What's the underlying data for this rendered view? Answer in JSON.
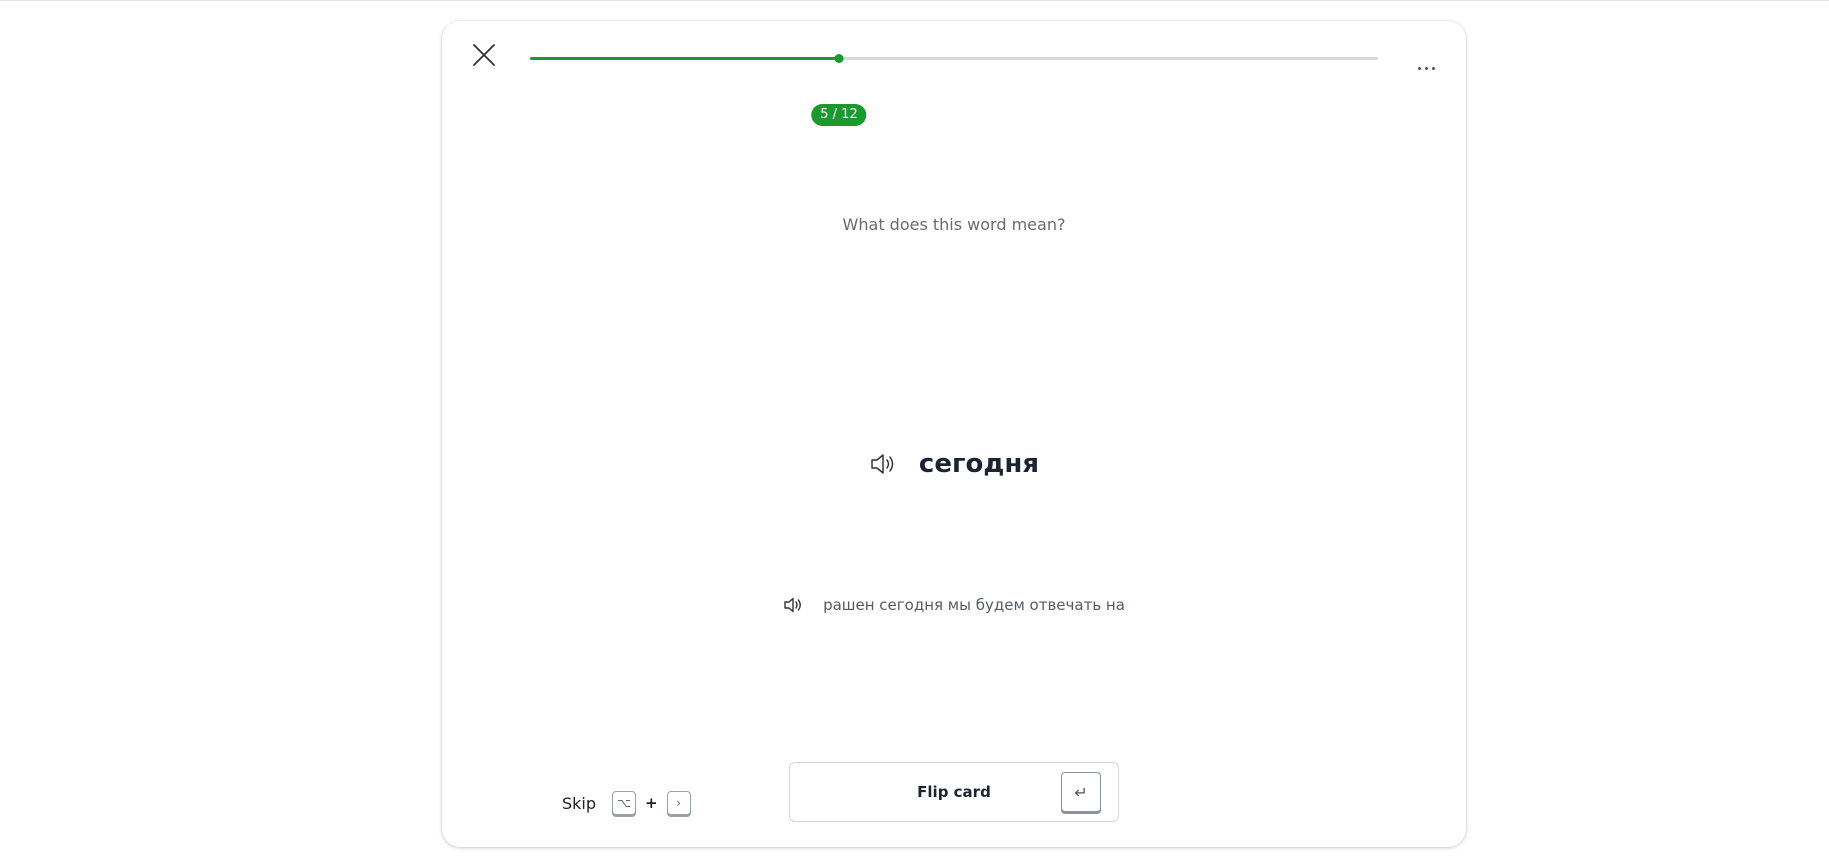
{
  "header": {
    "progress": {
      "current": 5,
      "total": 12,
      "label": "5 / 12",
      "fraction": 0.364
    }
  },
  "card": {
    "prompt": "What does this word mean?",
    "word": "сегодня",
    "example_sentence": "рашен сегодня мы будем отвечать на"
  },
  "footer": {
    "skip_label": "Skip",
    "skip_keys": [
      "⌥",
      "+",
      "›"
    ],
    "flip_label": "Flip card",
    "flip_key": "↵"
  },
  "colors": {
    "accent": "#1a9a2e",
    "text_dark": "#1c2433",
    "text_muted": "#6b6b6b"
  },
  "icons": {
    "close": "close-icon",
    "more": "more-horizontal-icon",
    "speaker": "speaker-icon",
    "option_key": "option-key-icon",
    "next_key": "chevron-right-icon",
    "enter_key": "enter-key-icon"
  }
}
